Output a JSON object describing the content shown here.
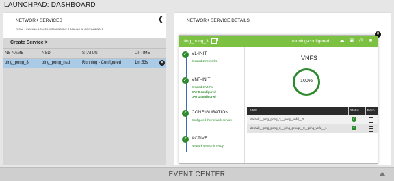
{
  "app": {
    "title": "LAUNCHPAD: DASHBOARD"
  },
  "left_panel": {
    "title": "NETWORK SERVICES",
    "counters": "TOTAL: 1   RUNNING: 1   FAILED: 0   SCALING OUT: 0   SCALING IN: 0   INITIALIZING: 0",
    "collapse_icon": "chevron-left-icon",
    "create_label": "Create Service >",
    "table": {
      "headers": [
        "NS NAME",
        "NSD",
        "STATUS",
        "UPTIME"
      ],
      "rows": [
        {
          "name": "ping_pong_3",
          "nsd": "ping_pong_nsd",
          "status": "Running - Configured",
          "uptime": "1m:53s"
        }
      ]
    }
  },
  "right_panel": {
    "title": "NETWORK SERVICE DETAILS",
    "card": {
      "name": "ping_pong_3",
      "state": "running-configured",
      "bar_color": "#7dc142",
      "icons": [
        "cloud-icon",
        "monitor-icon",
        "clock-icon",
        "stop-icon"
      ],
      "steps": [
        {
          "title": "VL-INIT",
          "subs": [
            "Created 2 networks"
          ]
        },
        {
          "title": "VNF-INIT",
          "subs": [
            "Created 2 VNFs.",
            "DAY 0 configured",
            "DAY 1 configured"
          ]
        },
        {
          "title": "CONFIGURATION",
          "subs": [
            "Configured the network service"
          ]
        },
        {
          "title": "ACTIVE",
          "subs": [
            "Network service is ready"
          ]
        }
      ],
      "vnfs": {
        "title": "VNFS",
        "percent": "100%",
        "headers": [
          "VNF",
          "Status",
          "Reco"
        ],
        "rows": [
          {
            "name": "default__ping_pong_3__pong_vnfd__2"
          },
          {
            "name": "default__ping_pong_3__ping_group__0__ping_vnfd__1"
          }
        ]
      }
    }
  },
  "event_center": {
    "title": "EVENT CENTER"
  }
}
